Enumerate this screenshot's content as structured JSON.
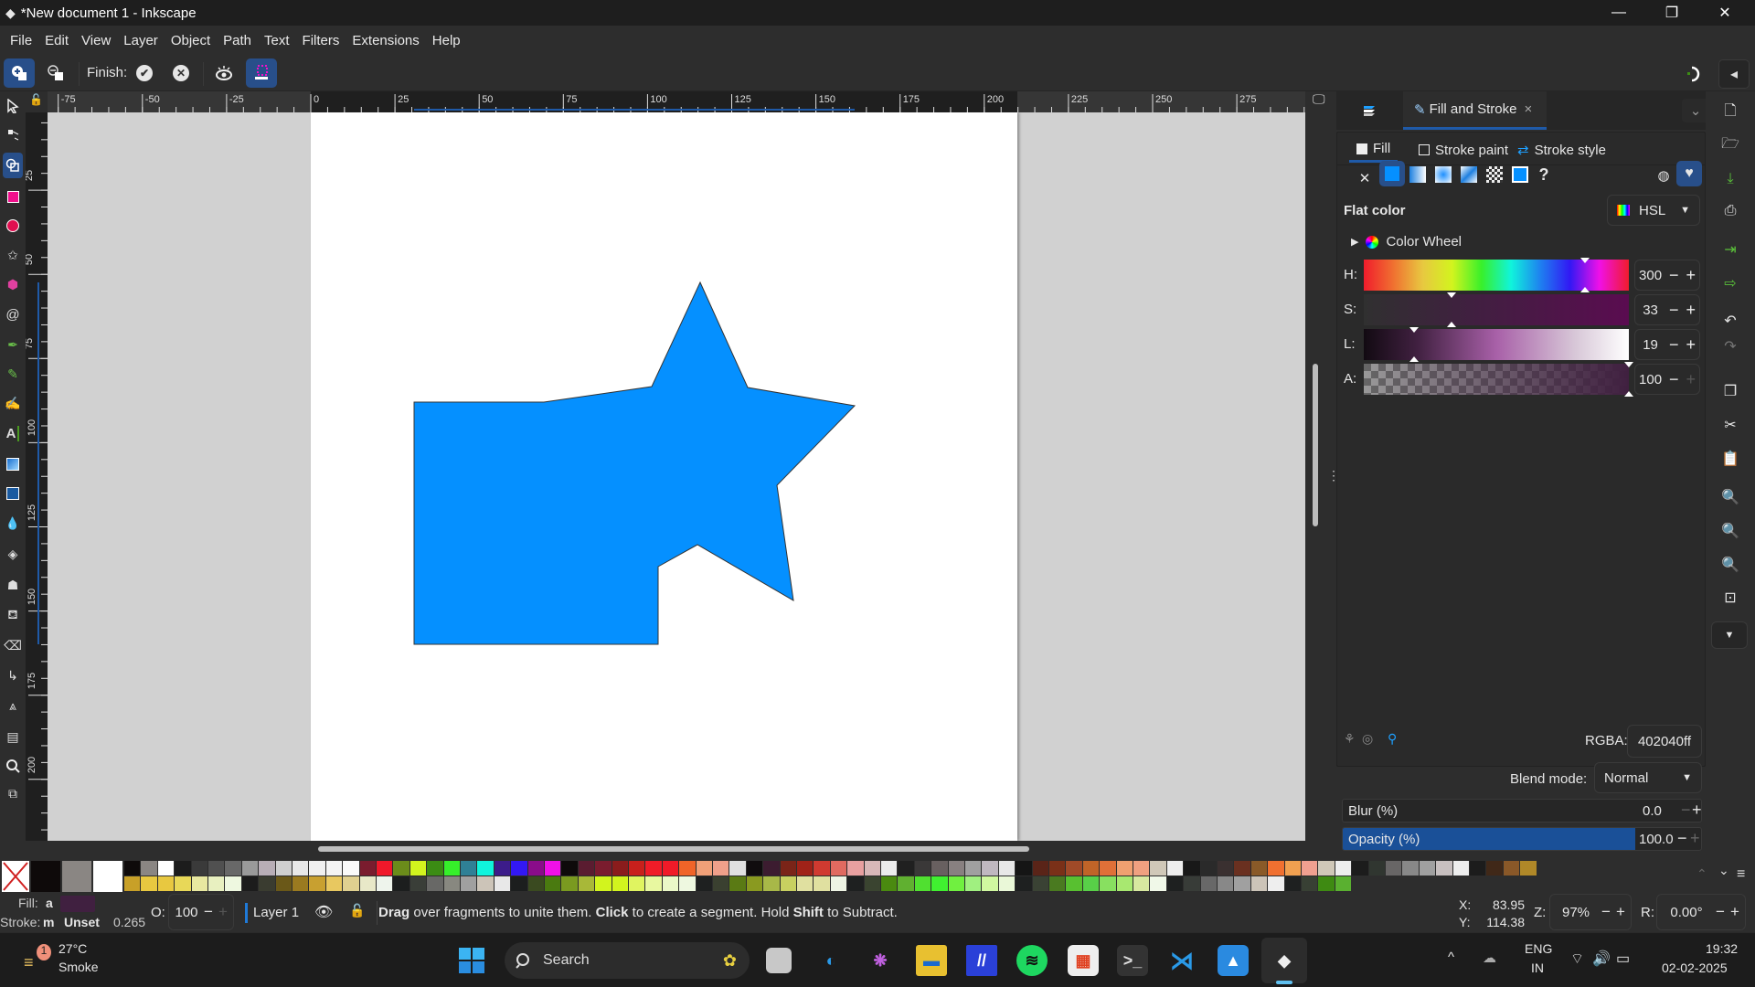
{
  "window": {
    "title": "*New document 1 - Inkscape",
    "controls": {
      "minimize": "—",
      "maximize": "❐",
      "close": "✕"
    }
  },
  "menu": [
    "File",
    "Edit",
    "View",
    "Layer",
    "Object",
    "Path",
    "Text",
    "Filters",
    "Extensions",
    "Help"
  ],
  "tool_controls": {
    "finish_label": "Finish:",
    "add_mode": "add-mode-icon",
    "delete_mode": "delete-mode-icon",
    "confirm": "✔",
    "cancel": "✕",
    "visibility": "eye-icon",
    "selection_mode": "selection-mode-icon"
  },
  "rulers": {
    "horizontal": [
      "-75",
      "-50",
      "-25",
      "0",
      "25",
      "50",
      "75",
      "100",
      "125",
      "150",
      "175",
      "200",
      "225",
      "250",
      "275"
    ],
    "vertical": [
      "25",
      "50",
      "75",
      "100",
      "125",
      "150",
      "175",
      "200"
    ]
  },
  "canvas": {
    "shape_fill": "#0590ff",
    "shape_stroke": "#333333",
    "shape_name": "united star and rectangle path"
  },
  "toolbox": [
    "selector",
    "node",
    "shape-builder",
    "rectangle",
    "ellipse",
    "star",
    "3d-box",
    "spiral",
    "pen",
    "pencil",
    "calligraphy",
    "text",
    "gradient",
    "mesh",
    "dropper",
    "paint-bucket",
    "tweak",
    "spray",
    "eraser",
    "connector",
    "measure",
    "pages",
    "zoom",
    "clone"
  ],
  "panel": {
    "tabs": [
      {
        "label": "Fill and Stroke",
        "close": "×"
      }
    ],
    "subtabs": [
      "Fill",
      "Stroke paint",
      "Stroke style"
    ],
    "paint_types": [
      "no-paint",
      "flat-color",
      "linear-gradient",
      "radial-gradient",
      "mesh-gradient",
      "pattern",
      "swatch",
      "unset"
    ],
    "unset_label": "?",
    "flat_color_label": "Flat color",
    "color_mode": "HSL",
    "color_wheel_label": "Color Wheel",
    "channels": [
      {
        "label": "H:",
        "value": "300",
        "fraction": 0.833
      },
      {
        "label": "S:",
        "value": "33",
        "fraction": 0.33
      },
      {
        "label": "L:",
        "value": "19",
        "fraction": 0.19
      },
      {
        "label": "A:",
        "value": "100",
        "fraction": 1.0
      }
    ],
    "rgba_label": "RGBA:",
    "rgba_value": "402040ff",
    "blend_label": "Blend mode:",
    "blend_value": "Normal",
    "blur_label": "Blur (%)",
    "blur_value": "0.0",
    "opacity_label": "Opacity (%)",
    "opacity_value": "100.0",
    "opacity_fraction": 1.0
  },
  "palette": {
    "top": [
      "#0e0a0a",
      "#8a8683",
      "#ffffff",
      "#1c1c1c",
      "#3a3a3a",
      "#505050",
      "#686868",
      "#9a9a9a",
      "#b8aeb6",
      "#cfcfcf",
      "#e8e8e8",
      "#f0f0f0",
      "#f4f4f4",
      "#fafafa",
      "#7a1c2e",
      "#f0182a",
      "#6b8c1a",
      "#d2f41e",
      "#3b8c14",
      "#36f02a",
      "#2f8096",
      "#10f4dc",
      "#3c1c8a",
      "#3218f4",
      "#8a0c8a",
      "#f010e8",
      "#0e0a0a",
      "#5a1c30",
      "#7a1c2e",
      "#8a1c1c",
      "#c8201c",
      "#f01c28",
      "#f01a28",
      "#f06428",
      "#f0a078",
      "#f0a08a",
      "#e0e0e0",
      "#100c0e",
      "#3c1c30",
      "#7a2418",
      "#a02218",
      "#d03a30",
      "#e06a60",
      "#e8a0a0",
      "#d8b8b8",
      "#ececec",
      "#202020",
      "#3a3838",
      "#686060",
      "#888080",
      "#a0a0a0",
      "#c0b8c0",
      "#e8e8e8",
      "#151515",
      "#5a2418",
      "#7a3018",
      "#a04a28",
      "#c06428",
      "#e07038",
      "#f0a070",
      "#f0a080",
      "#d0c8b8",
      "#eeeeee",
      "#181818",
      "#2a2a2a",
      "#3a3030",
      "#6a3020",
      "#8a5a28",
      "#f07030",
      "#f0a050",
      "#f0a090",
      "#d0c8b8",
      "#eeeeee",
      "#1c1c1c",
      "#303630",
      "#686666",
      "#888888",
      "#a0a0a0",
      "#c8c0c0",
      "#eeeeee",
      "#1c1c1c",
      "#402818",
      "#8a5828",
      "#b08828"
    ],
    "bottom": [
      "#c8a028",
      "#e8c840",
      "#e8c840",
      "#e8d858",
      "#e8e8a0",
      "#e8f0c0",
      "#eef8e0",
      "#1c1c1c",
      "#3a3c30",
      "#6a5818",
      "#9a7a20",
      "#c8a030",
      "#e8c860",
      "#e0d090",
      "#e8e8c8",
      "#eef4ec",
      "#1c1e1e",
      "#3a3e38",
      "#686866",
      "#888880",
      "#a0a0a0",
      "#ccc4b8",
      "#e8e8e8",
      "#1c1e1e",
      "#3a4a20",
      "#4a7a10",
      "#7a9a20",
      "#a8b838",
      "#d2f41e",
      "#d2f41e",
      "#e0f460",
      "#e8f8a0",
      "#eaf8c8",
      "#eef8e0",
      "#1e2020",
      "#3a4030",
      "#5a7a14",
      "#8a9a20",
      "#a8b848",
      "#c8d060",
      "#e0e0a0",
      "#e0e0a0",
      "#eef4e4",
      "#1e2020",
      "#3a4430",
      "#4a8a10",
      "#60b030",
      "#50e030",
      "#40f030",
      "#70f040",
      "#a0f080",
      "#d0f8a0",
      "#eaf8d8",
      "#1e2020",
      "#3a4234",
      "#4a7a20",
      "#58c030",
      "#58d048",
      "#88e060",
      "#a8e870",
      "#d8e8a0",
      "#f0f8e8",
      "#1e2020",
      "#383c38",
      "#686868",
      "#888888",
      "#a0a0a0",
      "#ccc4b8",
      "#eeeeee",
      "#1e2020",
      "#384034",
      "#3e8a12",
      "#5ab030"
    ],
    "none_label": "none-swatch"
  },
  "status": {
    "fill_label": "Fill:",
    "fill_value": "a",
    "fill_color": "#402040",
    "stroke_label": "Stroke:",
    "stroke_value": "m",
    "stroke_unset": "Unset",
    "stroke_width": "0.265",
    "opacity_label": "O:",
    "opacity_value": "100",
    "layer": "Layer 1",
    "message_parts": [
      {
        "text": "Drag",
        "bold": true
      },
      {
        "text": " over fragments to unite them. ",
        "bold": false
      },
      {
        "text": "Click",
        "bold": true
      },
      {
        "text": " to create a segment. Hold ",
        "bold": false
      },
      {
        "text": "Shift",
        "bold": true
      },
      {
        "text": " to Subtract.",
        "bold": false
      }
    ],
    "x_label": "X:",
    "x_value": "83.95",
    "y_label": "Y:",
    "y_value": "114.38",
    "zoom_label": "Z:",
    "zoom_value": "97%",
    "rotate_label": "R:",
    "rotate_value": "0.00°"
  },
  "taskbar": {
    "weather_temp": "27°C",
    "weather_desc": "Smoke",
    "weather_badge": "1",
    "search_placeholder": "Search",
    "apps": [
      "task-view",
      "edge",
      "copilot",
      "file-explorer",
      "app-m",
      "spotify",
      "store",
      "terminal",
      "vscode",
      "photos",
      "inkscape"
    ],
    "lang_top": "ENG",
    "lang_bottom": "IN",
    "time": "19:32",
    "date": "02-02-2025"
  }
}
